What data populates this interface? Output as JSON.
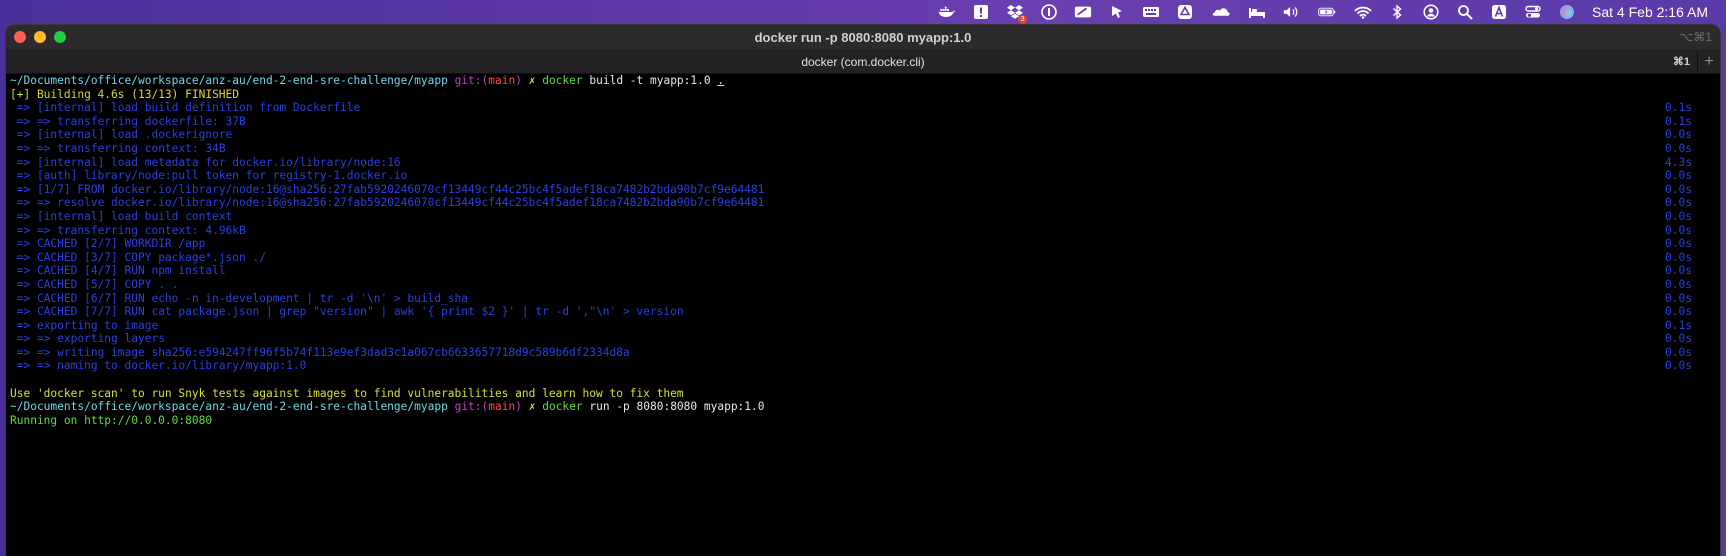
{
  "menubar": {
    "icons": [
      "docker-icon",
      "exclamation-box-icon",
      "dropbox-icon",
      "onepassword-icon",
      "pen-box-icon",
      "pointer-icon",
      "keyboard-icon",
      "google-drive-icon",
      "cloudflare-icon",
      "bed-icon",
      "volume-icon",
      "battery-icon",
      "wifi-icon",
      "bluetooth-icon",
      "user-icon",
      "search-icon",
      "font-icon",
      "control-center-icon",
      "siri-icon"
    ],
    "dropbox_badge": "3",
    "clock": "Sat 4 Feb  2:16 AM"
  },
  "window": {
    "title": "docker run -p 8080:8080 myapp:1.0",
    "title_shortcut": "⌥⌘1",
    "tab_label": "docker (com.docker.cli)",
    "tab_shortcut": "⌘1",
    "tab_plus": "+"
  },
  "terminal": {
    "prompt1": {
      "path": "~/Documents/office/workspace/anz-au/end-2-end-sre-challenge/myapp",
      "git_prefix": "git:(",
      "branch": "main",
      "git_suffix": ")",
      "mark": "✗",
      "cmd": "docker",
      "args": "build -t myapp:1.0",
      "dot": "."
    },
    "build_header": "[+] Building 4.6s (13/13) FINISHED",
    "steps": [
      {
        "text": "=> [internal] load build definition from Dockerfile",
        "time": "0.1s"
      },
      {
        "text": "=> => transferring dockerfile: 37B",
        "time": "0.1s"
      },
      {
        "text": "=> [internal] load .dockerignore",
        "time": "0.0s"
      },
      {
        "text": "=> => transferring context: 34B",
        "time": "0.0s"
      },
      {
        "text": "=> [internal] load metadata for docker.io/library/node:16",
        "time": "4.3s"
      },
      {
        "text": "=> [auth] library/node:pull token for registry-1.docker.io",
        "time": "0.0s"
      },
      {
        "text": "=> [1/7] FROM docker.io/library/node:16@sha256:27fab5920246070cf13449cf44c25bc4f5adef18ca7482b2bda90b7cf9e64481",
        "time": "0.0s"
      },
      {
        "text": "=> => resolve docker.io/library/node:16@sha256:27fab5920246070cf13449cf44c25bc4f5adef18ca7482b2bda90b7cf9e64481",
        "time": "0.0s"
      },
      {
        "text": "=> [internal] load build context",
        "time": "0.0s"
      },
      {
        "text": "=> => transferring context: 4.96kB",
        "time": "0.0s"
      },
      {
        "text": "=> CACHED [2/7] WORKDIR /app",
        "time": "0.0s"
      },
      {
        "text": "=> CACHED [3/7] COPY package*.json ./",
        "time": "0.0s"
      },
      {
        "text": "=> CACHED [4/7] RUN npm install",
        "time": "0.0s"
      },
      {
        "text": "=> CACHED [5/7] COPY . .",
        "time": "0.0s"
      },
      {
        "text": "=> CACHED [6/7] RUN echo -n in-development | tr -d '\\n' > build_sha",
        "time": "0.0s"
      },
      {
        "text": "=> CACHED [7/7] RUN cat package.json | grep \"version\" | awk '{ print $2 }' | tr -d ',\"\\n' > version",
        "time": "0.0s"
      },
      {
        "text": "=> exporting to image",
        "time": "0.1s"
      },
      {
        "text": "=> => exporting layers",
        "time": "0.0s"
      },
      {
        "text": "=> => writing image sha256:e594247ff96f5b74f113e9ef3dad3c1a067cb6633657718d9c589b6df2334d8a",
        "time": "0.0s"
      },
      {
        "text": "=> => naming to docker.io/library/myapp:1.0",
        "time": "0.0s"
      }
    ],
    "scan_hint": "Use 'docker scan' to run Snyk tests against images to find vulnerabilities and learn how to fix them",
    "prompt2": {
      "path": "~/Documents/office/workspace/anz-au/end-2-end-sre-challenge/myapp",
      "git_prefix": "git:(",
      "branch": "main",
      "git_suffix": ")",
      "mark": "✗",
      "cmd": "docker",
      "args": "run -p 8080:8080 myapp:1.0"
    },
    "output": "Running on http://0.0.0.0:8080"
  },
  "colors": {
    "menubar_bg": "#5b3fa0",
    "terminal_bg": "#000000",
    "step_blue": "#2b3fe0",
    "success_green": "#5fdc3a",
    "hint_yellow": "#dede3a",
    "prompt_cyan": "#4fd6e4",
    "branch_red": "#ff4848"
  }
}
